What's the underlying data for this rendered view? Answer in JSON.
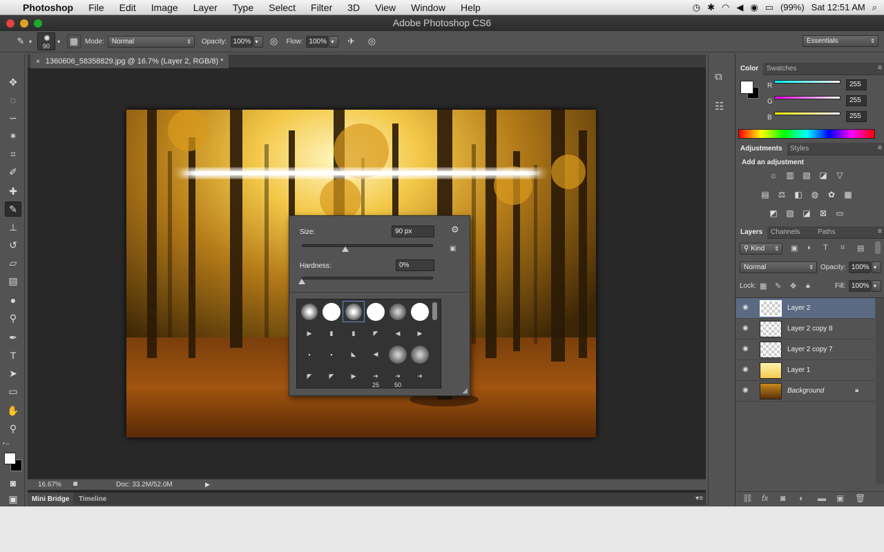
{
  "menubar": {
    "app_name": "Photoshop",
    "items": [
      "File",
      "Edit",
      "Image",
      "Layer",
      "Type",
      "Select",
      "Filter",
      "3D",
      "View",
      "Window",
      "Help"
    ],
    "battery": "(99%)",
    "clock": "Sat 12:51 AM"
  },
  "window": {
    "title": "Adobe Photoshop CS6"
  },
  "options_bar": {
    "brush_size": "90",
    "mode_label": "Mode:",
    "mode_value": "Normal",
    "opacity_label": "Opacity:",
    "opacity_value": "100%",
    "flow_label": "Flow:",
    "flow_value": "100%",
    "workspace": "Essentials"
  },
  "document": {
    "tab_title": "1360606_58358829.jpg @ 16.7% (Layer 2, RGB/8) *",
    "zoom": "16.67%",
    "doc_size": "Doc: 33.2M/52.0M"
  },
  "bottom_panel": {
    "tabs": [
      "Mini Bridge",
      "Timeline"
    ]
  },
  "brush_picker": {
    "size_label": "Size:",
    "size_value": "90 px",
    "size_fraction": 0.33,
    "hardness_label": "Hardness:",
    "hardness_value": "0%",
    "hardness_fraction": 0.0,
    "brush_numbers": [
      "25",
      "50"
    ]
  },
  "color_panel": {
    "tabs": [
      "Color",
      "Swatches"
    ],
    "r_label": "R",
    "r_value": "255",
    "g_label": "G",
    "g_value": "255",
    "b_label": "B",
    "b_value": "255"
  },
  "adjustments_panel": {
    "tabs": [
      "Adjustments",
      "Styles"
    ],
    "heading": "Add an adjustment"
  },
  "layers_panel": {
    "tabs": [
      "Layers",
      "Channels",
      "Paths"
    ],
    "filter_kind": "Kind",
    "blend_mode": "Normal",
    "opacity_label": "Opacity:",
    "opacity_value": "100%",
    "lock_label": "Lock:",
    "fill_label": "Fill:",
    "fill_value": "100%",
    "layers": [
      {
        "name": "Layer 2",
        "selected": true
      },
      {
        "name": "Layer 2 copy 8",
        "selected": false
      },
      {
        "name": "Layer 2 copy 7",
        "selected": false
      },
      {
        "name": "Layer 1",
        "selected": false
      },
      {
        "name": "Background",
        "selected": false
      }
    ]
  },
  "colors": {
    "ui_bg": "#535353",
    "selected_layer": "#5b6a82",
    "canvas_bg": "#282828"
  }
}
